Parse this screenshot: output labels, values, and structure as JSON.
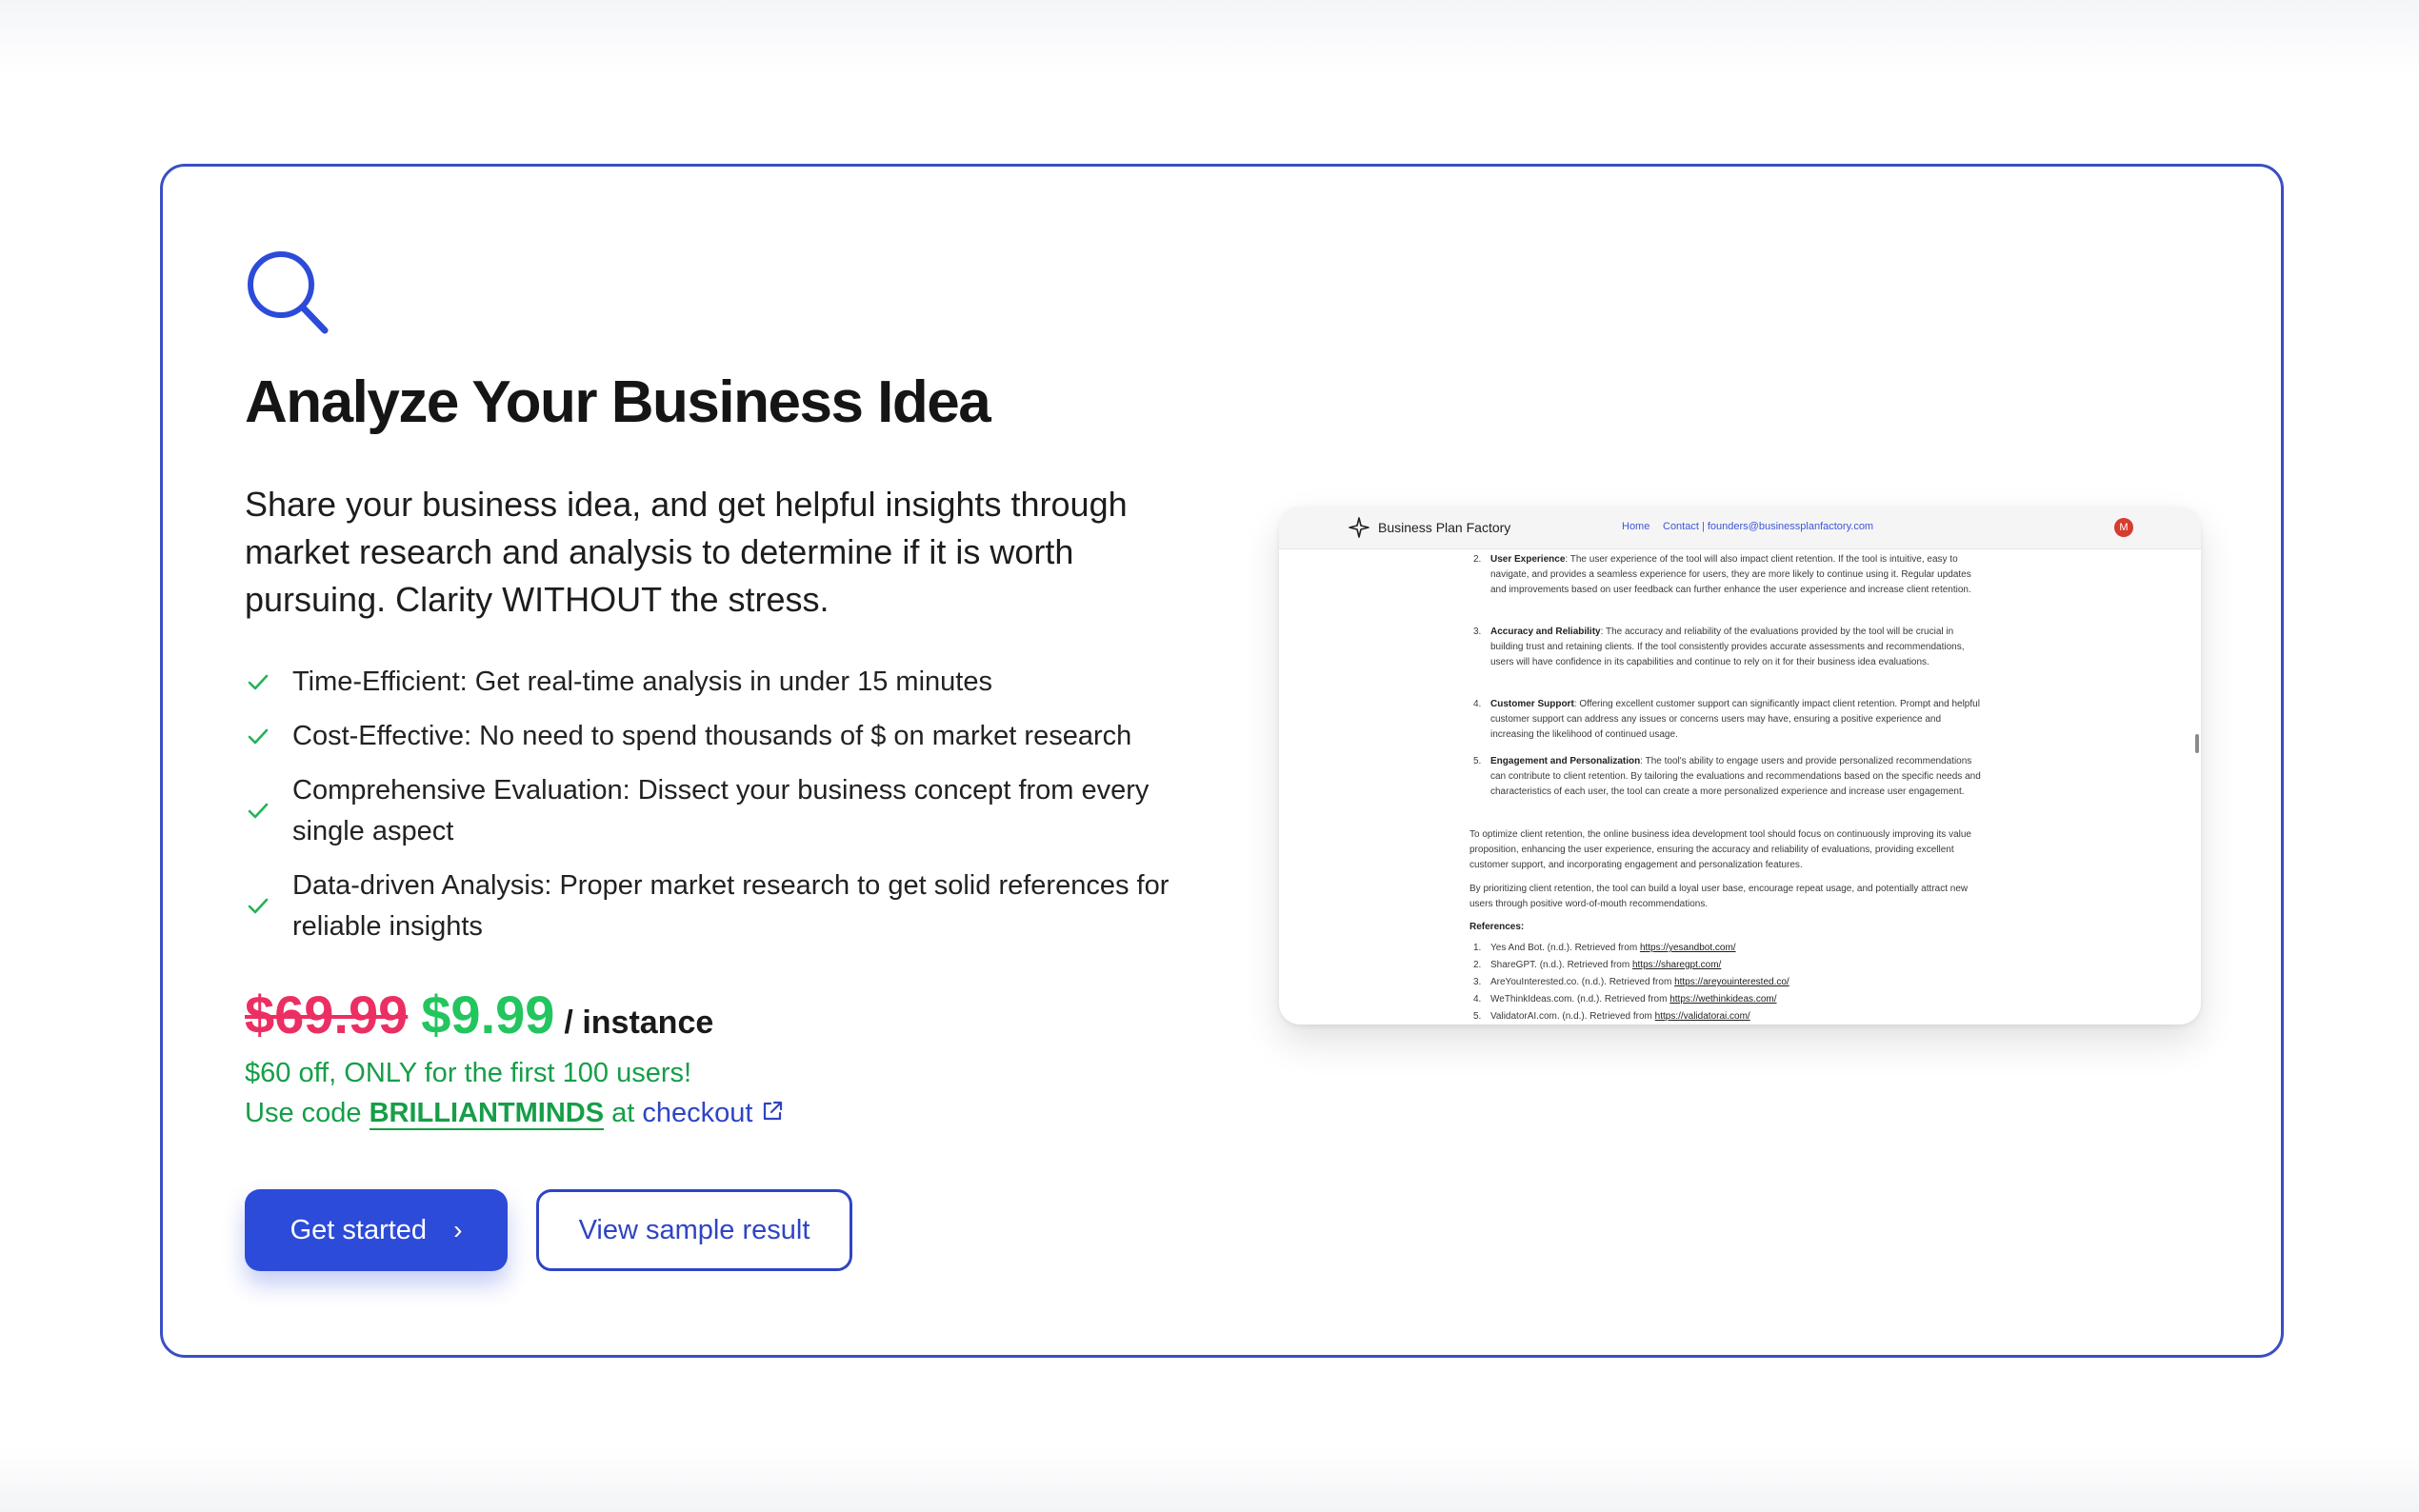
{
  "card": {
    "title": "Analyze Your Business Idea",
    "description": "Share your business idea, and get helpful insights through market research and analysis to determine if it is worth pursuing. Clarity WITHOUT the stress.",
    "features": [
      "Time-Efficient: Get real-time analysis in under 15 minutes",
      "Cost-Effective: No need to spend thousands of $ on market research",
      "Comprehensive Evaluation: Dissect your business concept from every single aspect",
      "Data-driven Analysis: Proper market research to get solid references for reliable insights"
    ],
    "pricing": {
      "old_price": "$69.99",
      "new_price": "$9.99",
      "unit": "/ instance"
    },
    "promo": {
      "line1": "$60 off, ONLY for the first 100 users!",
      "prefix": "Use code",
      "code": "BRILLIANTMINDS",
      "at": "at",
      "checkout_label": "checkout"
    },
    "buttons": {
      "get_started": "Get started",
      "get_started_chevron": "›",
      "view_sample": "View sample result"
    }
  },
  "preview": {
    "brand": "Business Plan Factory",
    "nav_home": "Home",
    "nav_contact": "Contact | founders@businessplanfactory.com",
    "avatar_initial": "M",
    "items": [
      {
        "num": "2.",
        "head": "User Experience",
        "text": ": The user experience of the tool will also impact client retention. If the tool is intuitive, easy to navigate, and provides a seamless experience for users, they are more likely to continue using it. Regular updates and improvements based on user feedback can further enhance the user experience and increase client retention."
      },
      {
        "num": "3.",
        "head": "Accuracy and Reliability",
        "text": ": The accuracy and reliability of the evaluations provided by the tool will be crucial in building trust and retaining clients. If the tool consistently provides accurate assessments and recommendations, users will have confidence in its capabilities and continue to rely on it for their business idea evaluations."
      },
      {
        "num": "4.",
        "head": "Customer Support",
        "text": ": Offering excellent customer support can significantly impact client retention. Prompt and helpful customer support can address any issues or concerns users may have, ensuring a positive experience and increasing the likelihood of continued usage."
      },
      {
        "num": "5.",
        "head": "Engagement and Personalization",
        "text": ": The tool's ability to engage users and provide personalized recommendations can contribute to client retention. By tailoring the evaluations and recommendations based on the specific needs and characteristics of each user, the tool can create a more personalized experience and increase user engagement."
      }
    ],
    "paragraphs": [
      "To optimize client retention, the online business idea development tool should focus on continuously improving its value proposition, enhancing the user experience, ensuring the accuracy and reliability of evaluations, providing excellent customer support, and incorporating engagement and personalization features.",
      "By prioritizing client retention, the tool can build a loyal user base, encourage repeat usage, and potentially attract new users through positive word-of-mouth recommendations."
    ],
    "references_title": "References:",
    "references": [
      {
        "num": "1.",
        "text": "Yes And Bot. (n.d.). Retrieved from ",
        "url": "https://yesandbot.com/"
      },
      {
        "num": "2.",
        "text": "ShareGPT. (n.d.). Retrieved from ",
        "url": "https://sharegpt.com/"
      },
      {
        "num": "3.",
        "text": "AreYouInterested.co. (n.d.). Retrieved from ",
        "url": "https://areyouinterested.co/"
      },
      {
        "num": "4.",
        "text": "WeThinkIdeas.com. (n.d.). Retrieved from ",
        "url": "https://wethinkideas.com/"
      },
      {
        "num": "5.",
        "text": "ValidatorAI.com. (n.d.). Retrieved from ",
        "url": "https://validatorai.com/"
      }
    ]
  },
  "colors": {
    "accent": "#2d4bd9",
    "border": "#3a4fc4",
    "old_price": "#ec2f63",
    "new_price": "#22c55e",
    "promo": "#169e48"
  },
  "icons": [
    "search-icon",
    "check-icon",
    "external-link-icon",
    "chevron-right-icon",
    "brand-logo-icon"
  ]
}
